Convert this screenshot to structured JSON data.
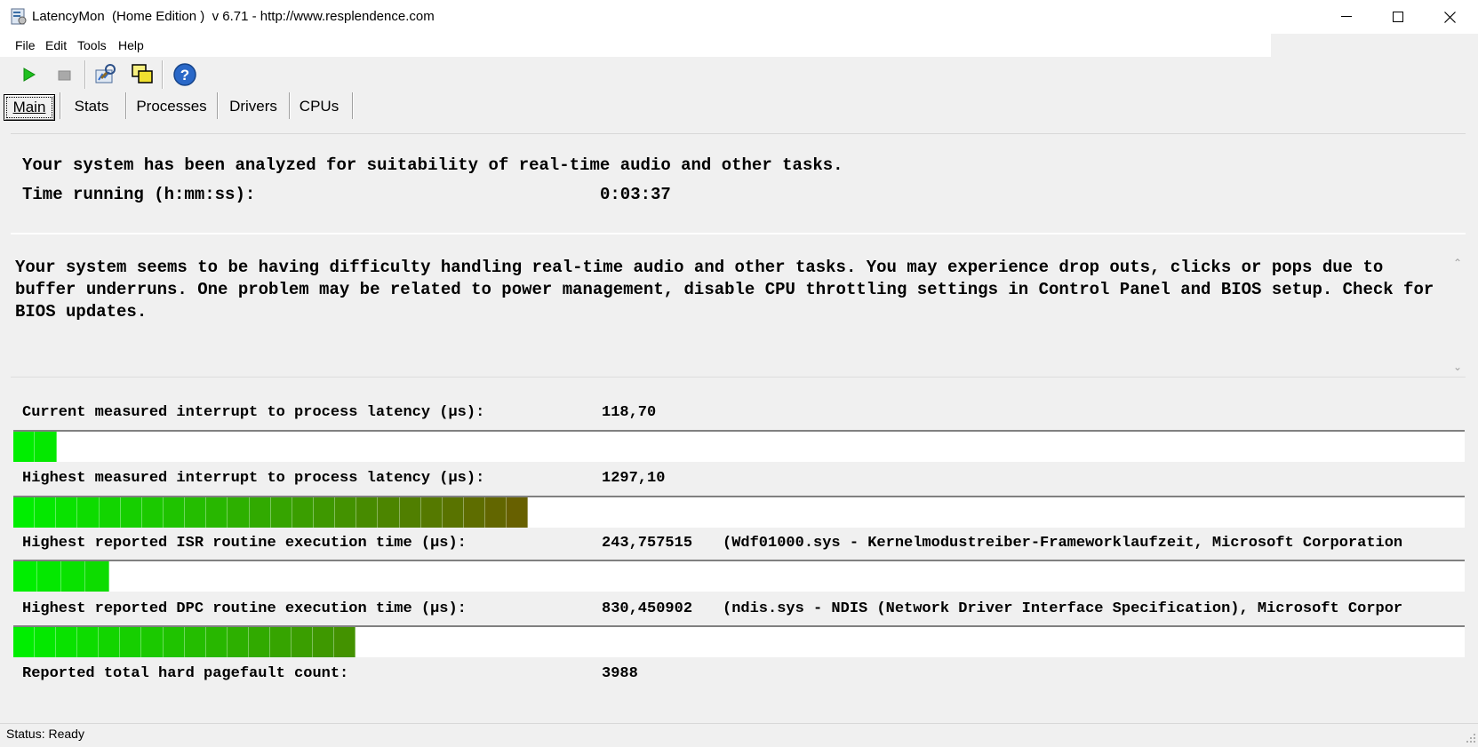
{
  "window": {
    "title": "LatencyMon  (Home Edition )  v 6.71 - http://www.resplendence.com",
    "minimize_icon": "minimize-icon",
    "maximize_icon": "maximize-icon",
    "close_icon": "close-icon"
  },
  "menu": [
    "File",
    "Edit",
    "Tools",
    "Help"
  ],
  "toolbar": {
    "icons": [
      "play-icon",
      "stop-icon",
      "analyze-icon",
      "window-icon",
      "help-icon"
    ]
  },
  "tabs": [
    "Main",
    "Stats",
    "Processes",
    "Drivers",
    "CPUs"
  ],
  "summary": {
    "analyzed_line": "Your system has been analyzed for suitability of real-time audio and other tasks.",
    "time_label": "Time running (h:mm:ss):",
    "time_value": "0:03:37"
  },
  "message": "Your system seems to be having difficulty handling real-time audio and other tasks. You may experience drop outs, clicks or pops due to buffer underruns. One problem may be related to power management, disable CPU throttling settings in Control Panel and BIOS setup. Check for BIOS updates.",
  "metrics": [
    {
      "label": "Current measured interrupt to process latency (µs):",
      "value": "118,70",
      "extra": "",
      "bar_level": 0.03
    },
    {
      "label": "Highest measured interrupt to process latency (µs):",
      "value": "1297,10",
      "extra": "",
      "bar_level": 0.355
    },
    {
      "label": "Highest reported ISR routine execution time (µs):",
      "value": "243,757515",
      "extra": "(Wdf01000.sys - Kernelmodustreiber-Frameworklaufzeit, Microsoft Corporation",
      "bar_level": 0.066
    },
    {
      "label": "Highest reported DPC routine execution time (µs):",
      "value": "830,450902",
      "extra": "(ndis.sys - NDIS (Network Driver Interface Specification), Microsoft Corpor",
      "bar_level": 0.236
    },
    {
      "label": "Reported total hard pagefault count:",
      "value": "3988",
      "extra": ""
    }
  ],
  "status": "Status: Ready",
  "colors": {
    "bar_start": "#00ee00",
    "bar_end": "#6b5a00"
  }
}
